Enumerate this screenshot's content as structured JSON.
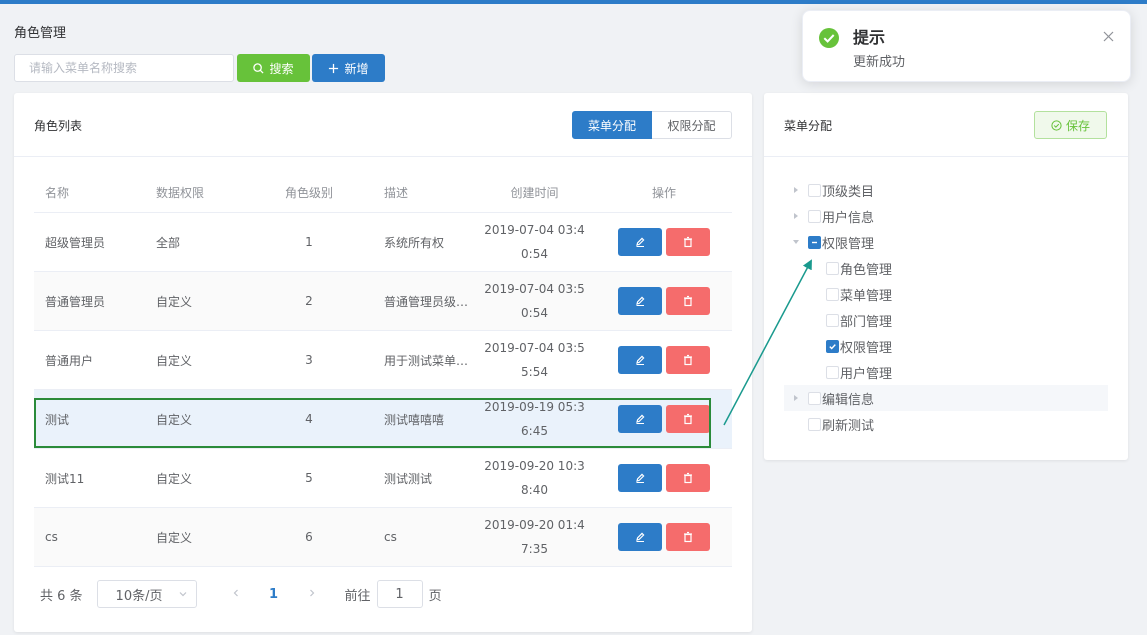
{
  "page": {
    "title": "角色管理"
  },
  "search": {
    "placeholder": "请输入菜单名称搜索",
    "search_label": "搜索",
    "add_label": "新增"
  },
  "role_list": {
    "title": "角色列表",
    "tabs": [
      {
        "label": "菜单分配",
        "active": true
      },
      {
        "label": "权限分配",
        "active": false
      }
    ],
    "columns": [
      "名称",
      "数据权限",
      "角色级别",
      "描述",
      "创建时间",
      "操作"
    ],
    "rows": [
      {
        "name": "超级管理员",
        "scope": "全部",
        "level": "1",
        "desc": "系统所有权",
        "time1": "2019-07-04 03:4",
        "time2": "0:54"
      },
      {
        "name": "普通管理员",
        "scope": "自定义",
        "level": "2",
        "desc": "普通管理员级…",
        "time1": "2019-07-04 03:5",
        "time2": "0:54"
      },
      {
        "name": "普通用户",
        "scope": "自定义",
        "level": "3",
        "desc": "用于测试菜单…",
        "time1": "2019-07-04 03:5",
        "time2": "5:54"
      },
      {
        "name": "测试",
        "scope": "自定义",
        "level": "4",
        "desc": "测试嘻嘻嘻",
        "time1": "2019-09-19 05:3",
        "time2": "6:45"
      },
      {
        "name": "测试11",
        "scope": "自定义",
        "level": "5",
        "desc": "测试测试",
        "time1": "2019-09-20 10:3",
        "time2": "8:40"
      },
      {
        "name": "cs",
        "scope": "自定义",
        "level": "6",
        "desc": "cs",
        "time1": "2019-09-20 01:4",
        "time2": "7:35"
      }
    ]
  },
  "pagination": {
    "total": "共 6 条",
    "page_size": "10条/页",
    "current": "1",
    "goto_prefix": "前往",
    "goto_value": "1",
    "goto_suffix": "页"
  },
  "menu_assign": {
    "title": "菜单分配",
    "save_label": "保存",
    "tree": [
      {
        "label": "顶级类目",
        "expandable": true,
        "expanded": false,
        "state": "unchecked"
      },
      {
        "label": "用户信息",
        "expandable": true,
        "expanded": false,
        "state": "unchecked"
      },
      {
        "label": "权限管理",
        "expandable": true,
        "expanded": true,
        "state": "indeterminate",
        "children": [
          {
            "label": "角色管理",
            "state": "unchecked"
          },
          {
            "label": "菜单管理",
            "state": "unchecked"
          },
          {
            "label": "部门管理",
            "state": "unchecked"
          },
          {
            "label": "权限管理",
            "state": "checked"
          },
          {
            "label": "用户管理",
            "state": "unchecked"
          }
        ]
      },
      {
        "label": "编辑信息",
        "expandable": true,
        "expanded": false,
        "state": "unchecked"
      },
      {
        "label": "刷新测试",
        "expandable": false,
        "expanded": false,
        "state": "unchecked"
      }
    ]
  },
  "notification": {
    "title": "提示",
    "message": "更新成功"
  },
  "colors": {
    "primary": "#2d7cc8",
    "success": "#67c23a",
    "danger": "#f56c6c",
    "highlight_border": "#2a8b3a",
    "arrow": "#1a9a8e"
  }
}
